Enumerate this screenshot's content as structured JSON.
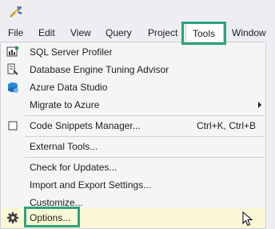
{
  "menubar": {
    "items": [
      {
        "label": "File"
      },
      {
        "label": "Edit"
      },
      {
        "label": "View"
      },
      {
        "label": "Query"
      },
      {
        "label": "Project"
      },
      {
        "label": "Tools"
      },
      {
        "label": "Window"
      }
    ],
    "active": "Tools"
  },
  "tools_menu": {
    "items": [
      {
        "label": "SQL Server Profiler",
        "icon": "sql-profiler-icon"
      },
      {
        "label": "Database Engine Tuning Advisor",
        "icon": "tuning-advisor-icon"
      },
      {
        "label": "Azure Data Studio",
        "icon": "azure-data-studio-icon"
      },
      {
        "label": "Migrate to Azure",
        "submenu": true
      },
      {
        "label": "Code Snippets Manager...",
        "shortcut": "Ctrl+K, Ctrl+B",
        "icon": "checkbox-icon"
      },
      {
        "label": "External Tools..."
      },
      {
        "label": "Check for Updates..."
      },
      {
        "label": "Import and Export Settings..."
      },
      {
        "label": "Customize..."
      },
      {
        "label": "Options...",
        "icon": "gear-icon",
        "hovered": true
      }
    ]
  },
  "colors": {
    "highlight_box": "#2ea37b",
    "hover_background": "#fbf8d6",
    "menu_background": "#f5f5f5",
    "chrome_background": "#eeeef2"
  }
}
